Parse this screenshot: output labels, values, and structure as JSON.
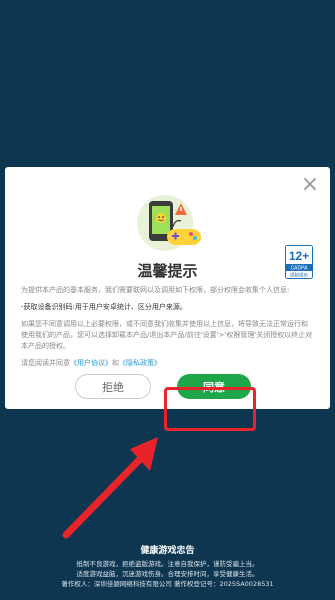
{
  "dialog": {
    "title": "温馨提示",
    "close_icon": "×",
    "intro": "为提供本产品的基本服务，我们需要联网以及调用如下权限，部分权限会收集个人信息:",
    "permission": "-获取设备识别码:用于用户安卓统计、区分用户来源。",
    "notice": "如果您不同意调用以上必要权限，或不同意我们收集并使用以上信息，将导致无法正常运行和使用我们的产品，您可以选择卸载本产品/退出本产品/前往'设置'>'权限管理'关闭授权以终止对本产品的授权。",
    "agreement_prefix": "请您阅读并同意",
    "user_agreement_link": "《用户协议》",
    "and": "和",
    "privacy_link": "《隐私政策》",
    "reject_label": "拒绝",
    "agree_label": "同意",
    "age_rating": {
      "age": "12+",
      "org": "CADPA",
      "note": "适龄提示"
    }
  },
  "footer": {
    "title": "健康游戏忠告",
    "lines": [
      "抵制不良游戏，拒绝盗版游戏。注意自我保护，谨防受骗上当。",
      "适度游戏益脑，沉迷游戏伤身。合理安排时间，享受健康生活。",
      "著作权人：深圳佳颖网络科技有限公司    著作权登记号：2025SA0028531"
    ]
  },
  "colors": {
    "background": "#0f3651",
    "agree_button": "#1fa64a",
    "highlight": "#e8242a",
    "link": "#2a9bd6"
  }
}
